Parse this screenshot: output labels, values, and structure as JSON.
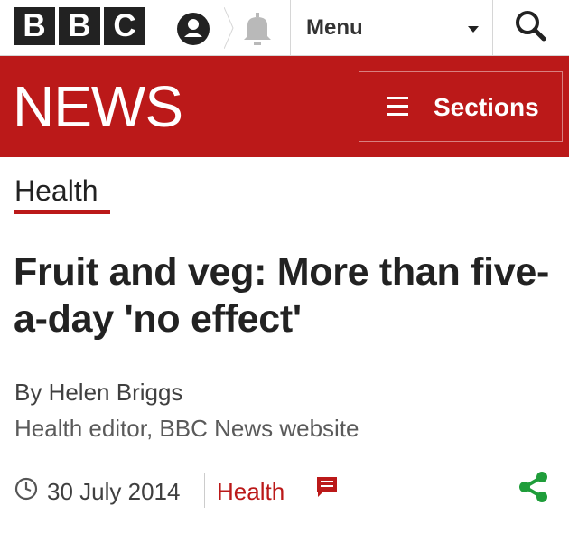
{
  "brand": {
    "letters": [
      "B",
      "B",
      "C"
    ]
  },
  "topbar": {
    "menu_label": "Menu"
  },
  "news": {
    "logo_text": "NEWS",
    "sections_label": "Sections"
  },
  "article": {
    "section": "Health",
    "headline": "Fruit and veg: More than five-a-day 'no effect'",
    "author": "By Helen Briggs",
    "author_role": "Health editor, BBC News website",
    "date": "30 July 2014",
    "meta_section": "Health"
  },
  "icons": {
    "account": "account-icon",
    "notifications": "bell-icon",
    "menu_caret": "chevron-down-icon",
    "search": "search-icon",
    "sections": "hamburger-icon",
    "date": "clock-icon",
    "comments": "comment-icon",
    "share": "share-icon"
  },
  "colors": {
    "brand_red": "#bb1919",
    "share_green": "#1f9d3a",
    "logo_black": "#222222"
  }
}
